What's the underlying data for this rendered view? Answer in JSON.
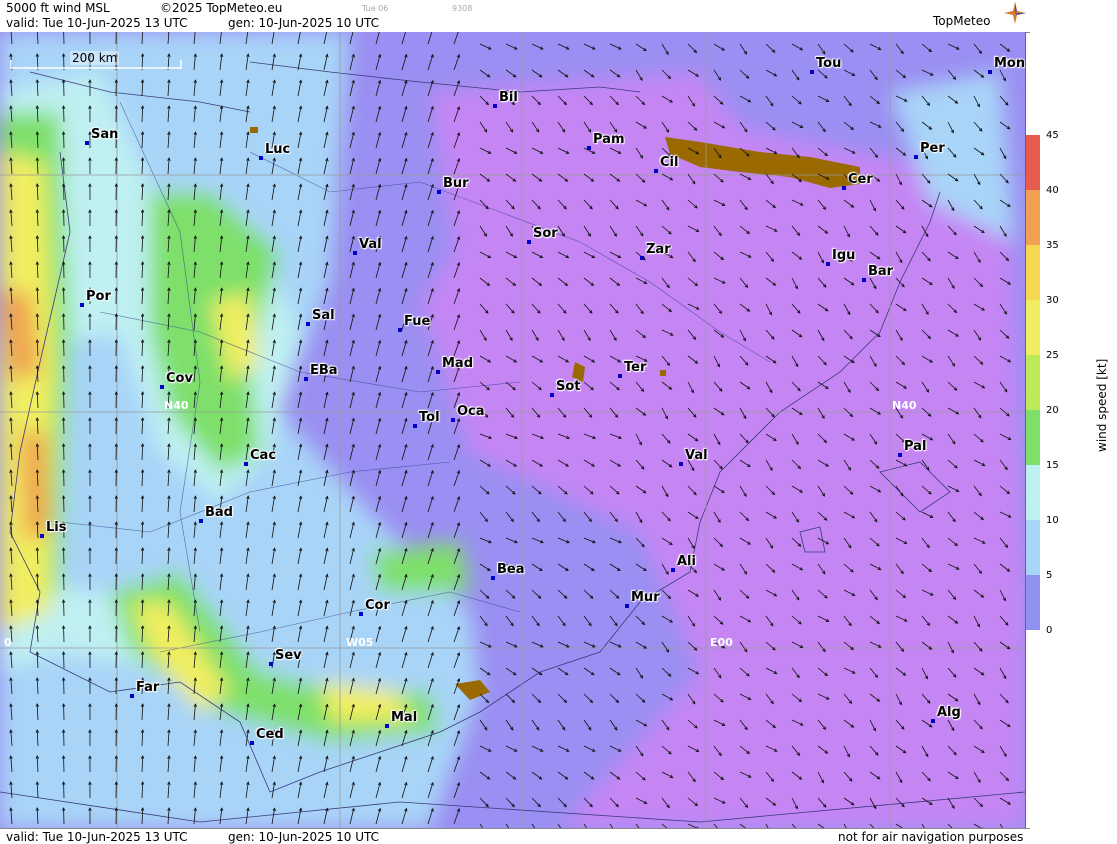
{
  "header": {
    "product": "5000 ft wind MSL",
    "copyright": "©2025 TopMeteo.eu",
    "valid": "valid:  Tue  10-Jun-2025  13 UTC",
    "gen": "gen: 10-Jun-2025 10 UTC",
    "faint_day": "Tue 06",
    "faint_code": "9308",
    "logo": "TopMeteo"
  },
  "footer": {
    "valid": "valid:  Tue  10-Jun-2025  13 UTC",
    "gen": "gen: 10-Jun-2025 10 UTC",
    "disclaimer": "not for air navigation purposes"
  },
  "scale_label": "200 km",
  "grid_labels": {
    "n40_west": "N40",
    "n40_east": "N40",
    "w05": "W05",
    "e00": "E00",
    "zero": "0"
  },
  "cities": [
    {
      "name": "Tou"
    },
    {
      "name": "Mon"
    },
    {
      "name": "Bil"
    },
    {
      "name": "San"
    },
    {
      "name": "Pam"
    },
    {
      "name": "Luc"
    },
    {
      "name": "Cil"
    },
    {
      "name": "Per"
    },
    {
      "name": "Bur"
    },
    {
      "name": "Cer"
    },
    {
      "name": "Sor"
    },
    {
      "name": "Val"
    },
    {
      "name": "Zar"
    },
    {
      "name": "Igu"
    },
    {
      "name": "Bar"
    },
    {
      "name": "Por"
    },
    {
      "name": "Sal"
    },
    {
      "name": "Fue"
    },
    {
      "name": "Mad"
    },
    {
      "name": "EBa"
    },
    {
      "name": "Cov"
    },
    {
      "name": "Ter"
    },
    {
      "name": "Sot"
    },
    {
      "name": "Tol"
    },
    {
      "name": "Oca"
    },
    {
      "name": "Pal"
    },
    {
      "name": "Cac"
    },
    {
      "name": "Val"
    },
    {
      "name": "Bad"
    },
    {
      "name": "Lis"
    },
    {
      "name": "Ali"
    },
    {
      "name": "Bea"
    },
    {
      "name": "Mur"
    },
    {
      "name": "Cor"
    },
    {
      "name": "Sev"
    },
    {
      "name": "Far"
    },
    {
      "name": "Mal"
    },
    {
      "name": "Alg"
    },
    {
      "name": "Ced"
    }
  ],
  "legend": {
    "title": "wind speed [kt]",
    "ticks": [
      "45",
      "40",
      "35",
      "30",
      "25",
      "20",
      "15",
      "10",
      "5",
      "0"
    ],
    "colors": [
      "#e65c4c",
      "#f0a050",
      "#f5d850",
      "#f0ee60",
      "#bdea5a",
      "#7ee06a",
      "#bff0f2",
      "#a8d4f8",
      "#9090f0",
      "#c080f4"
    ]
  }
}
